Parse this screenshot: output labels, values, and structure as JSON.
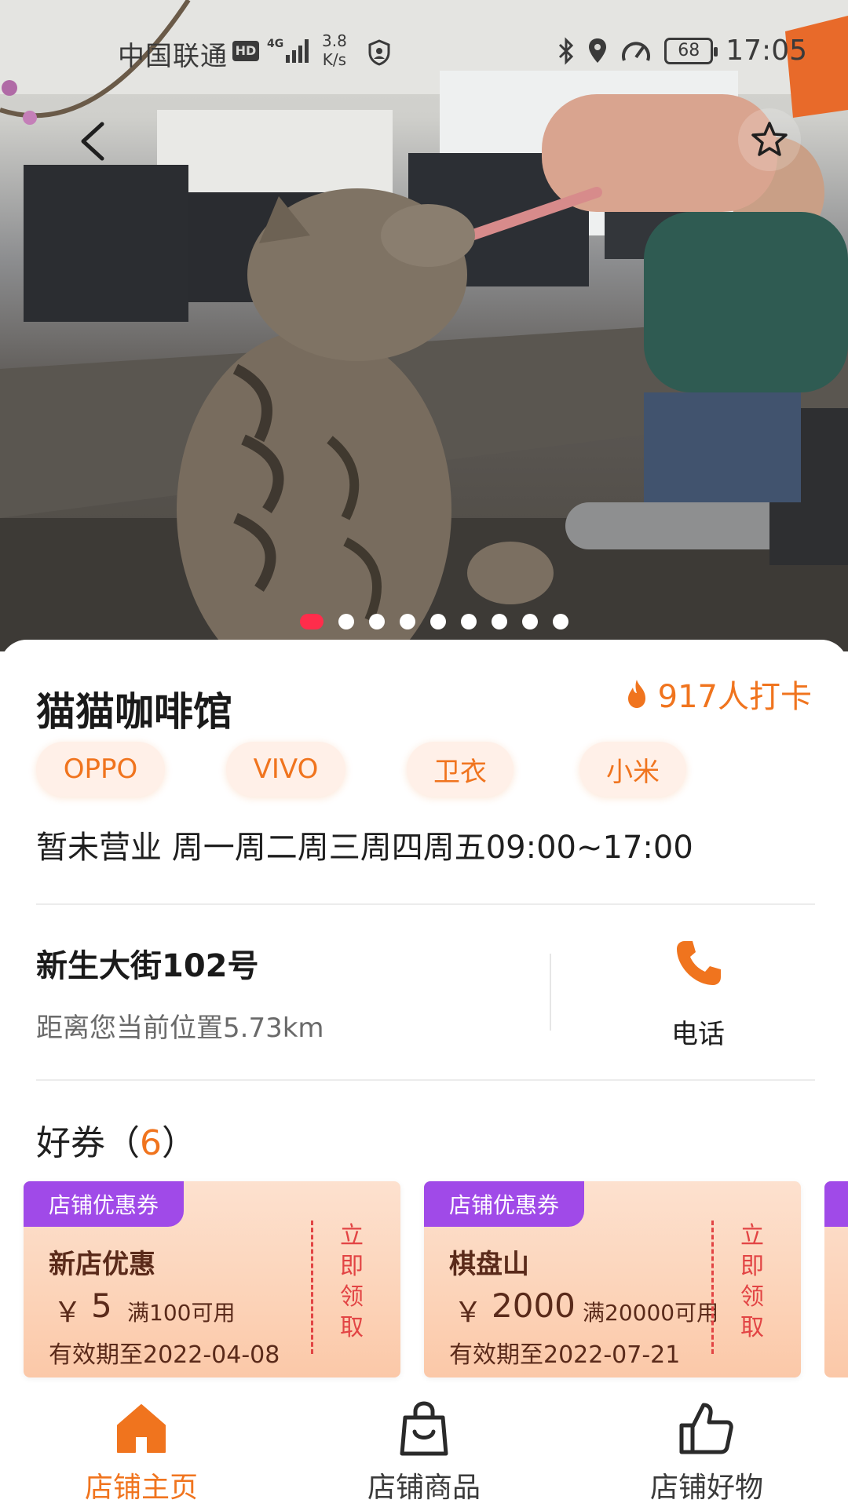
{
  "status_bar": {
    "carrier": "中国联通",
    "hd": "HD",
    "network": "4G",
    "speed_value": "3.8",
    "speed_unit": "K/s",
    "battery": "68",
    "time": "17:05"
  },
  "hero": {
    "slide_count": 9,
    "active_slide": 1
  },
  "shop": {
    "name": "猫猫咖啡馆",
    "checkin_text": "917人打卡",
    "tags": [
      "OPPO",
      "VIVO",
      "卫衣",
      "小米"
    ],
    "hours": "暂未营业 周一周二周三周四周五09:00~17:00",
    "address": "新生大街102号",
    "distance": "距离您当前位置5.73km",
    "phone_label": "电话"
  },
  "coupons": {
    "title_prefix": "好券（",
    "count": "6",
    "title_suffix": "）",
    "items": [
      {
        "badge": "店铺优惠券",
        "title": "新店优惠",
        "currency": "￥",
        "amount": "5",
        "condition": "满100可用",
        "validity": "有效期至2022-04-08",
        "claim": [
          "立",
          "即",
          "领",
          "取"
        ]
      },
      {
        "badge": "店铺优惠券",
        "title": "棋盘山",
        "currency": "￥",
        "amount": "2000",
        "condition": "满20000可用",
        "validity": "有效期至2022-07-21",
        "claim": [
          "立",
          "即",
          "领",
          "取"
        ]
      }
    ]
  },
  "bottom_nav": {
    "items": [
      {
        "label": "店铺主页",
        "icon": "home-icon",
        "active": true
      },
      {
        "label": "店铺商品",
        "icon": "shopping-bag-icon",
        "active": false
      },
      {
        "label": "店铺好物",
        "icon": "thumbs-up-icon",
        "active": false
      }
    ]
  },
  "colors": {
    "accent": "#f0741e",
    "badge_purple": "#a04ae8",
    "claim_red": "#e24444",
    "active_dot": "#ff2d4b"
  }
}
